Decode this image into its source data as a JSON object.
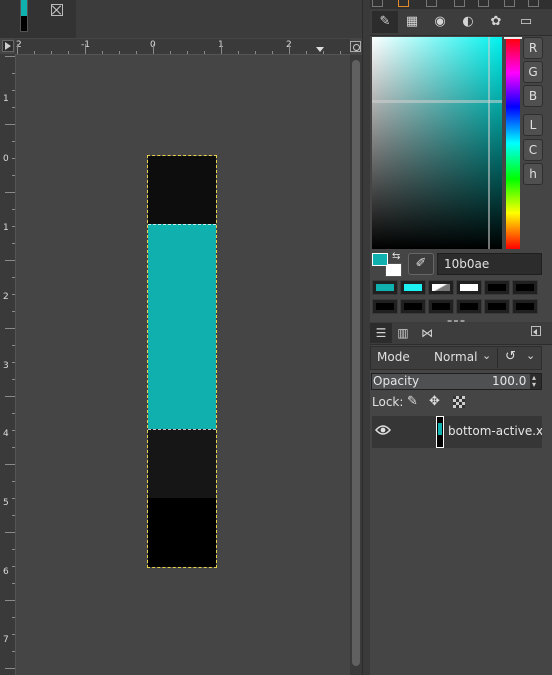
{
  "image_tab": {
    "close_icon": "close-icon"
  },
  "rulers": {
    "horizontal_labels": [
      "2",
      "-1",
      "0",
      "1",
      "2"
    ],
    "vertical_labels": [
      "1",
      "0",
      "1",
      "2",
      "3",
      "4",
      "5",
      "6",
      "7"
    ]
  },
  "canvas": {
    "bands": [
      {
        "color": "#0d0d0d"
      },
      {
        "color": "#10b0ae"
      },
      {
        "color": "#161616"
      },
      {
        "color": "#000000"
      }
    ],
    "selection_color": "#e6d14a"
  },
  "color_dock": {
    "tabs": [
      "gimp-logo-icon",
      "scale-icon",
      "watercolor-icon",
      "triangle-icon",
      "palette-icon",
      "scales-icon"
    ],
    "channels": [
      "R",
      "G",
      "B",
      "L",
      "C",
      "h"
    ],
    "fg_color": "#10b0ae",
    "bg_color": "#ffffff",
    "hex_value": "10b0ae",
    "history": [
      "#10b0ae",
      "#1cf0f0",
      "gradient",
      "#ffffff",
      "#000000",
      "#000000",
      "#000000",
      "#000000",
      "#000000",
      "#000000",
      "#000000",
      "#000000"
    ]
  },
  "layers": {
    "tabs": [
      "layers-icon",
      "channels-icon",
      "paths-icon"
    ],
    "mode_label": "Mode",
    "mode_value": "Normal",
    "opacity_label": "Opacity",
    "opacity_value": "100.0",
    "lock_label": "Lock:",
    "layer_name": "bottom-active.xp"
  },
  "chevron": "⌄"
}
